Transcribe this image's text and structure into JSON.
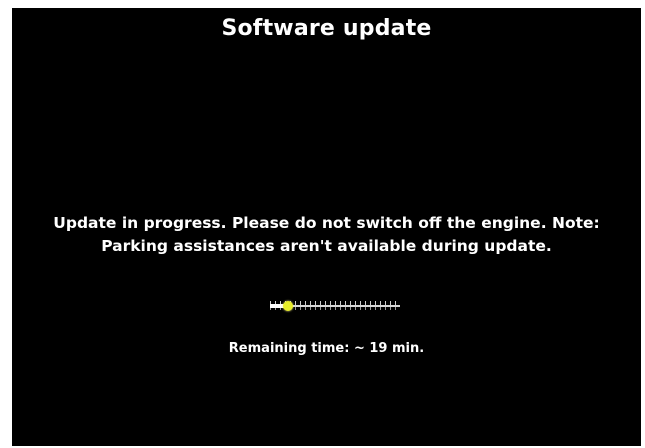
{
  "screen": {
    "title": "Software update",
    "message_line1": "Update in progress. Please do not switch off the engine. Note:",
    "message_line2": "Parking assistances aren't available during update.",
    "remaining_time": "Remaining time: ~ 19 min."
  },
  "progress": {
    "fraction": 0.14,
    "knob_color": "#e8ee2a"
  },
  "colors": {
    "background": "#000000",
    "text": "#ffffff"
  }
}
